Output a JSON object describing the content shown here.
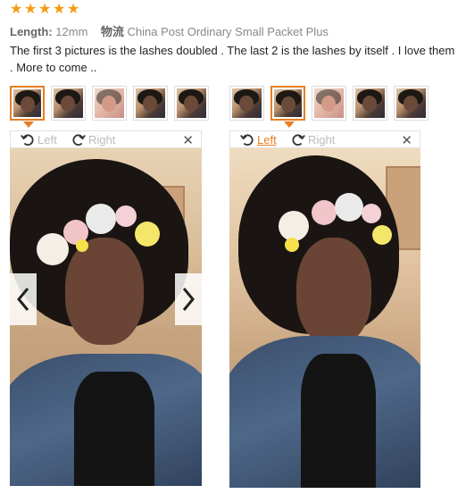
{
  "rating": {
    "stars": 5,
    "max": 5,
    "color": "#f39c12"
  },
  "meta": {
    "length_label": "Length:",
    "length_value": "12mm",
    "shipping_label": "物流",
    "shipping_value": "China Post Ordinary Small Packet Plus"
  },
  "review_text": "The first 3 pictures is the lashes doubled . The last 2 is the lashes by itself . I love them . More to come ..",
  "gallery_left": {
    "thumbnails": [
      "photo-1",
      "photo-2",
      "photo-3",
      "photo-4",
      "photo-5"
    ],
    "active_index": 0,
    "rotate_left_label": "Left",
    "rotate_right_label": "Right",
    "close_icon": "close-icon",
    "prev_icon": "chevron-left-icon",
    "next_icon": "chevron-right-icon"
  },
  "gallery_right": {
    "thumbnails": [
      "photo-1",
      "photo-2",
      "photo-3",
      "photo-4",
      "photo-5"
    ],
    "active_index": 1,
    "rotate_left_label": "Left",
    "rotate_right_label": "Right",
    "close_icon": "close-icon"
  },
  "colors": {
    "accent": "#e67e22",
    "star": "#f39c12"
  }
}
